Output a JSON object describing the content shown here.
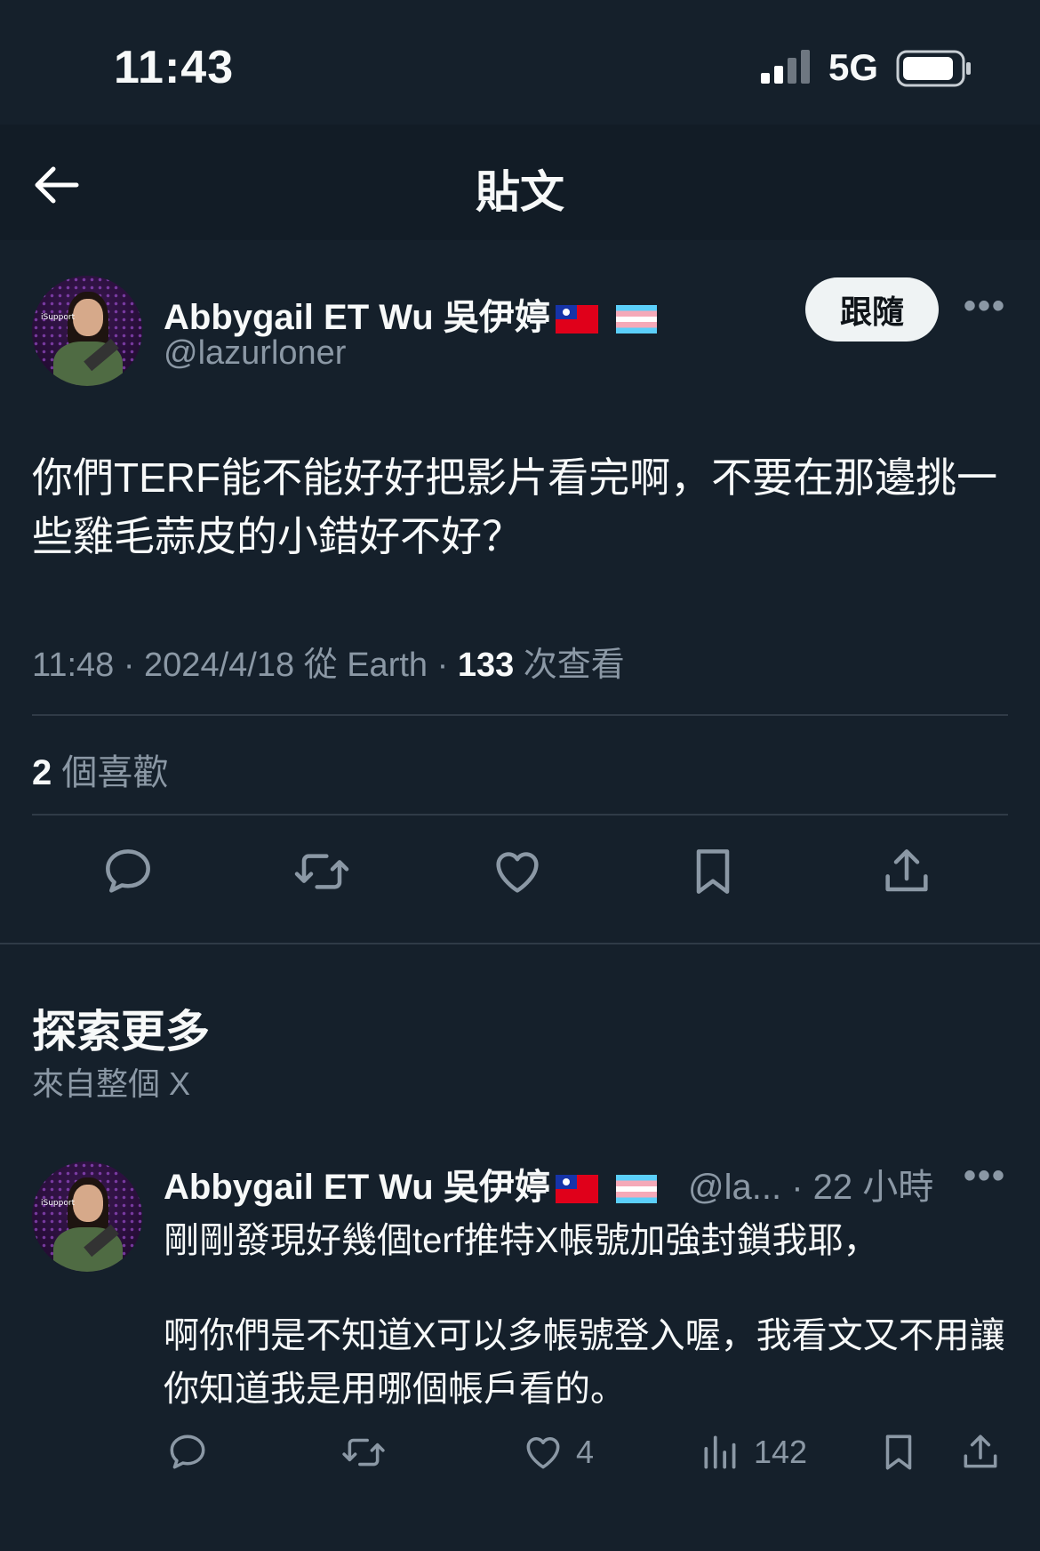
{
  "status_bar": {
    "time": "11:43",
    "network": "5G"
  },
  "header": {
    "title": "貼文"
  },
  "post": {
    "author_name": "Abbygail ET Wu 吳伊婷",
    "author_handle": "@lazurloner",
    "follow_label": "跟隨",
    "text": "你們TERF能不能好好把影片看完啊，不要在那邊挑一些雞毛蒜皮的小錯好不好？",
    "timestamp": "11:48 · 2024/4/18 從 Earth · ",
    "views_count": "133",
    "views_label": " 次查看",
    "likes_count": "2",
    "likes_label": " 個喜歡"
  },
  "explore": {
    "title": "探索更多",
    "subtitle": "來自整個 X"
  },
  "recommended": {
    "author_name": "Abbygail ET Wu 吳伊婷",
    "handle_time": "@la... · 22 小時",
    "text_line1": "剛剛發現好幾個terf推特X帳號加強封鎖我耶，",
    "text_para2": "啊你們是不知道X可以多帳號登入喔，我看文又不用讓你知道我是用哪個帳戶看的。",
    "likes": "4",
    "views": "142"
  },
  "icons": [
    "back-arrow-icon",
    "reply-icon",
    "retweet-icon",
    "like-icon",
    "bookmark-icon",
    "share-icon",
    "views-icon",
    "more-icon",
    "taiwan-flag-icon",
    "transgender-flag-icon"
  ],
  "colors": {
    "background": "#15202b",
    "text": "#f7f9f9",
    "muted": "#8b98a5",
    "divider": "#2f3b47",
    "follow_bg": "#eff3f4"
  }
}
